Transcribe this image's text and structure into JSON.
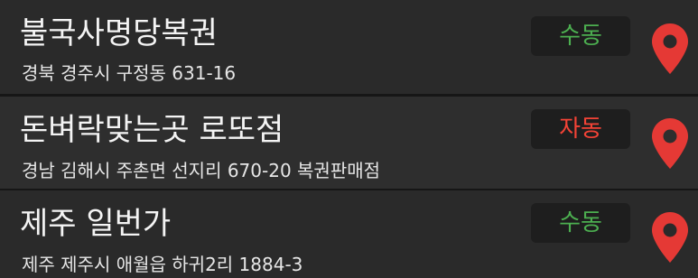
{
  "colors": {
    "manual": "#4caf50",
    "auto": "#f44336",
    "pin": "#e53935"
  },
  "stores": [
    {
      "name": "불국사명당복권",
      "address": "경북 경주시 구정동 631-16",
      "type_label": "수동",
      "type": "manual",
      "icon": "map-marker-icon"
    },
    {
      "name": "돈벼락맞는곳 로또점",
      "address": "경남 김해시 주촌면 선지리 670-20 복권판매점",
      "type_label": "자동",
      "type": "auto",
      "icon": "map-marker-icon"
    },
    {
      "name": "제주 일번가",
      "address": "제주 제주시 애월읍 하귀2리 1884-3",
      "type_label": "수동",
      "type": "manual",
      "icon": "map-marker-icon"
    }
  ]
}
